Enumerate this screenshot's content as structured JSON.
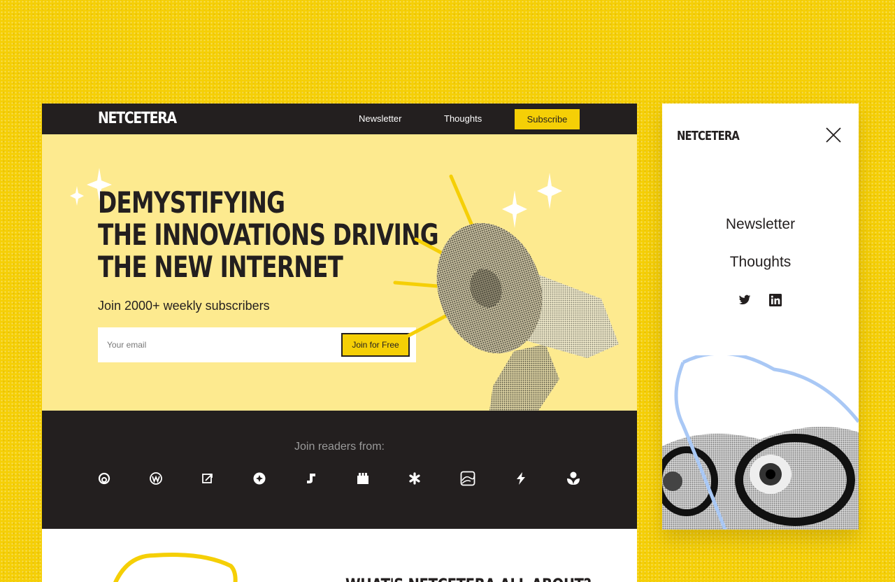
{
  "desktop": {
    "brand": "NETCETERA",
    "nav": {
      "newsletter": "Newsletter",
      "thoughts": "Thoughts",
      "subscribe": "Subscribe"
    },
    "hero": {
      "headline_lines": [
        "DEMYSTIFYING",
        "THE INNOVATIONS DRIVING",
        "THE NEW INTERNET"
      ],
      "tagline": "Join 2000+ weekly subscribers",
      "email_placeholder": "Your email",
      "cta": "Join for Free"
    },
    "readers": {
      "label": "Join readers from:",
      "logos": [
        "logo-a-icon",
        "logo-w-icon",
        "logo-arrow-icon",
        "logo-circle-icon",
        "logo-j-icon",
        "logo-block-icon",
        "logo-asterisk-icon",
        "logo-wave-icon",
        "logo-bolt-icon",
        "logo-flower-icon"
      ]
    },
    "about": {
      "title": "WHAT'S NETCETERA ALL ABOUT?"
    }
  },
  "mobile": {
    "brand": "NETCETERA",
    "menu": {
      "newsletter": "Newsletter",
      "thoughts": "Thoughts"
    },
    "social": [
      "twitter-icon",
      "linkedin-icon"
    ]
  },
  "colors": {
    "background": "#f5cf06",
    "dark": "#231f1f",
    "hero_bg": "#fdea8f",
    "accent": "#f5cf06",
    "blob_blue": "#a9c8f5"
  }
}
